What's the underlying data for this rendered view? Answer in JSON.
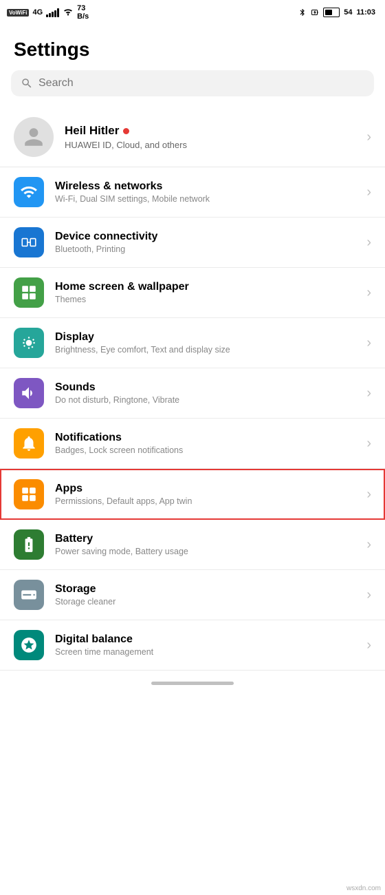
{
  "status": {
    "left": {
      "vowifi": "VoWiFi",
      "network": "4G",
      "signal_bars": [
        3,
        5,
        7,
        9,
        11
      ],
      "wifi": "wifi",
      "speed": "73 B/s"
    },
    "right": {
      "bluetooth": "bluetooth",
      "charging": "charging",
      "battery": "54",
      "time": "11:03"
    }
  },
  "page": {
    "title": "Settings"
  },
  "search": {
    "placeholder": "Search"
  },
  "profile": {
    "name": "Heil Hitler",
    "subtitle": "HUAWEI ID, Cloud, and others"
  },
  "settings_items": [
    {
      "id": "wireless",
      "title": "Wireless & networks",
      "subtitle": "Wi-Fi, Dual SIM settings, Mobile network",
      "icon_color": "icon-blue",
      "highlighted": false
    },
    {
      "id": "device-connectivity",
      "title": "Device connectivity",
      "subtitle": "Bluetooth, Printing",
      "icon_color": "icon-blue2",
      "highlighted": false
    },
    {
      "id": "home-screen",
      "title": "Home screen & wallpaper",
      "subtitle": "Themes",
      "icon_color": "icon-green",
      "highlighted": false
    },
    {
      "id": "display",
      "title": "Display",
      "subtitle": "Brightness, Eye comfort, Text and display size",
      "icon_color": "icon-teal",
      "highlighted": false
    },
    {
      "id": "sounds",
      "title": "Sounds",
      "subtitle": "Do not disturb, Ringtone, Vibrate",
      "icon_color": "icon-purple",
      "highlighted": false
    },
    {
      "id": "notifications",
      "title": "Notifications",
      "subtitle": "Badges, Lock screen notifications",
      "icon_color": "icon-amber",
      "highlighted": false
    },
    {
      "id": "apps",
      "title": "Apps",
      "subtitle": "Permissions, Default apps, App twin",
      "icon_color": "icon-orange",
      "highlighted": true
    },
    {
      "id": "battery",
      "title": "Battery",
      "subtitle": "Power saving mode, Battery usage",
      "icon_color": "icon-green2",
      "highlighted": false
    },
    {
      "id": "storage",
      "title": "Storage",
      "subtitle": "Storage cleaner",
      "icon_color": "icon-grey",
      "highlighted": false
    },
    {
      "id": "digital-balance",
      "title": "Digital balance",
      "subtitle": "Screen time management",
      "icon_color": "icon-teal2",
      "highlighted": false
    }
  ]
}
